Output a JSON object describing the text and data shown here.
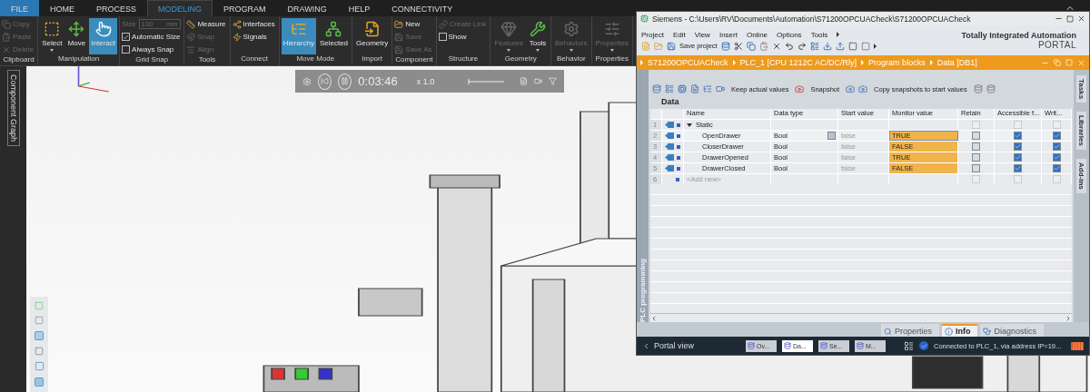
{
  "app_tabs": [
    {
      "label": "FILE",
      "kind": "file",
      "selected": false
    },
    {
      "label": "HOME",
      "kind": "tab",
      "selected": false
    },
    {
      "label": "PROCESS",
      "kind": "tab",
      "selected": false
    },
    {
      "label": "MODELING",
      "kind": "tab",
      "selected": true
    },
    {
      "label": "PROGRAM",
      "kind": "tab",
      "selected": false
    },
    {
      "label": "DRAWING",
      "kind": "tab",
      "selected": false
    },
    {
      "label": "HELP",
      "kind": "tab",
      "selected": false
    },
    {
      "label": "CONNECTIVITY",
      "kind": "tab",
      "selected": false
    }
  ],
  "ribbon": [
    {
      "label": "Clipboard",
      "items": [
        {
          "kind": "small",
          "label": "Copy",
          "disabled": true
        },
        {
          "kind": "small",
          "label": "Paste",
          "disabled": true
        },
        {
          "kind": "small",
          "label": "Delete",
          "disabled": true
        }
      ]
    },
    {
      "label": "Manipulation",
      "items": [
        {
          "kind": "large",
          "label": "Select",
          "disabled": false,
          "selected": false,
          "dropdown": true
        },
        {
          "kind": "large",
          "label": "Move",
          "disabled": false,
          "selected": false,
          "dropdown": false
        },
        {
          "kind": "large",
          "label": "Interact",
          "disabled": false,
          "selected": true,
          "dropdown": false
        }
      ]
    },
    {
      "label": "Grid Snap",
      "items": [
        {
          "kind": "field",
          "label": "Size",
          "value": "100",
          "unit": "mm",
          "disabled": true
        },
        {
          "kind": "check",
          "label": "Automatic Size",
          "checked": true,
          "disabled": false
        },
        {
          "kind": "check",
          "label": "Always Snap",
          "checked": false,
          "disabled": false
        }
      ]
    },
    {
      "label": "Tools",
      "items": [
        {
          "kind": "small",
          "label": "Measure",
          "disabled": false
        },
        {
          "kind": "small",
          "label": "Snap",
          "disabled": true
        },
        {
          "kind": "small",
          "label": "Align",
          "disabled": true
        }
      ]
    },
    {
      "label": "Connect",
      "items": [
        {
          "kind": "small",
          "label": "Interfaces",
          "disabled": false
        },
        {
          "kind": "small",
          "label": "Signals",
          "disabled": false
        }
      ]
    },
    {
      "label": "Move Mode",
      "items": [
        {
          "kind": "large",
          "label": "Hierarchy",
          "disabled": false,
          "selected": true,
          "dropdown": false
        },
        {
          "kind": "large",
          "label": "Selected",
          "disabled": false,
          "selected": false,
          "dropdown": false
        }
      ]
    },
    {
      "label": "Import",
      "items": [
        {
          "kind": "large",
          "label": "Geometry",
          "disabled": false,
          "selected": false,
          "dropdown": false
        }
      ]
    },
    {
      "label": "Component",
      "items": [
        {
          "kind": "small",
          "label": "New",
          "disabled": false
        },
        {
          "kind": "small",
          "label": "Save",
          "disabled": true
        },
        {
          "kind": "small",
          "label": "Save As",
          "disabled": true
        }
      ]
    },
    {
      "label": "Structure",
      "items": [
        {
          "kind": "small",
          "label": "Create Link",
          "disabled": true
        },
        {
          "kind": "check",
          "label": "Show",
          "checked": false,
          "disabled": false
        }
      ]
    },
    {
      "label": "Geometry",
      "items": [
        {
          "kind": "large",
          "label": "Features",
          "disabled": true,
          "selected": false,
          "dropdown": true
        },
        {
          "kind": "large",
          "label": "Tools",
          "disabled": false,
          "selected": false,
          "dropdown": true
        }
      ]
    },
    {
      "label": "Behavior",
      "items": [
        {
          "kind": "large",
          "label": "Behaviors",
          "disabled": true,
          "selected": false,
          "dropdown": true
        }
      ]
    },
    {
      "label": "Properties",
      "items": [
        {
          "kind": "large",
          "label": "Properties",
          "disabled": true,
          "selected": false,
          "dropdown": true
        }
      ]
    }
  ],
  "side_tab": "Component Graph",
  "playback": {
    "time": "0:03:46",
    "speed": "x 1.0"
  },
  "tia": {
    "title": "Siemens  -  C:\\Users\\RV\\Documents\\Automation\\S71200OPCUACheck\\S71200OPCUACheck",
    "menu": [
      "Project",
      "Edit",
      "View",
      "Insert",
      "Online",
      "Options",
      "Tools"
    ],
    "save_label": "Save project",
    "brand_line1": "Totally Integrated Automation",
    "brand_line2": "PORTAL",
    "breadcrumb": [
      "S71200OPCUACheck",
      "PLC_1 [CPU 1212C AC/DC/Rly]",
      "Program blocks",
      "Data [DB1]"
    ],
    "side_tab": "PLC programming",
    "right_tabs": [
      "Tasks",
      "Libraries",
      "Add-ins"
    ],
    "editor_toolbar": [
      "Keep actual values",
      "Snapshot",
      "Copy snapshots to start values"
    ],
    "block_title": "Data",
    "columns": [
      "Name",
      "Data type",
      "Start value",
      "Monitor value",
      "Retain",
      "Accessible f...",
      "Writ..."
    ],
    "rows": [
      {
        "num": "1",
        "kind": "struct",
        "name": "Static",
        "expanded": true,
        "data_type": "",
        "start_value": "",
        "monitor_value": "",
        "retain": false,
        "accessible": false,
        "writable": false,
        "selected": false
      },
      {
        "num": "2",
        "kind": "member",
        "name": "OpenDrawer",
        "data_type": "Bool",
        "start_value": "false",
        "monitor_value": "TRUE",
        "retain": false,
        "accessible": true,
        "writable": true,
        "selected": true
      },
      {
        "num": "3",
        "kind": "member",
        "name": "CloserDrawer",
        "data_type": "Bool",
        "start_value": "false",
        "monitor_value": "FALSE",
        "retain": false,
        "accessible": true,
        "writable": true,
        "selected": false
      },
      {
        "num": "4",
        "kind": "member",
        "name": "DrawerOpened",
        "data_type": "Bool",
        "start_value": "false",
        "monitor_value": "TRUE",
        "retain": false,
        "accessible": true,
        "writable": true,
        "selected": false
      },
      {
        "num": "5",
        "kind": "member",
        "name": "DrawerClosed",
        "data_type": "Bool",
        "start_value": "false",
        "monitor_value": "FALSE",
        "retain": false,
        "accessible": true,
        "writable": true,
        "selected": false
      },
      {
        "num": "6",
        "kind": "add",
        "name": "<Add new>",
        "data_type": "",
        "start_value": "",
        "monitor_value": "",
        "retain": false,
        "accessible": false,
        "writable": false,
        "selected": false
      }
    ],
    "bottom_tabs": [
      {
        "label": "Properties",
        "selected": false
      },
      {
        "label": "Info",
        "selected": true
      },
      {
        "label": "Diagnostics",
        "selected": false
      }
    ],
    "portal_view": "Portal view",
    "tasks": [
      {
        "label": "Ov...",
        "selected": false
      },
      {
        "label": "Da...",
        "selected": true
      },
      {
        "label": "Se...",
        "selected": false
      },
      {
        "label": "M...",
        "selected": false
      }
    ],
    "status_message": "Connected to PLC_1, via address IP=19..."
  }
}
